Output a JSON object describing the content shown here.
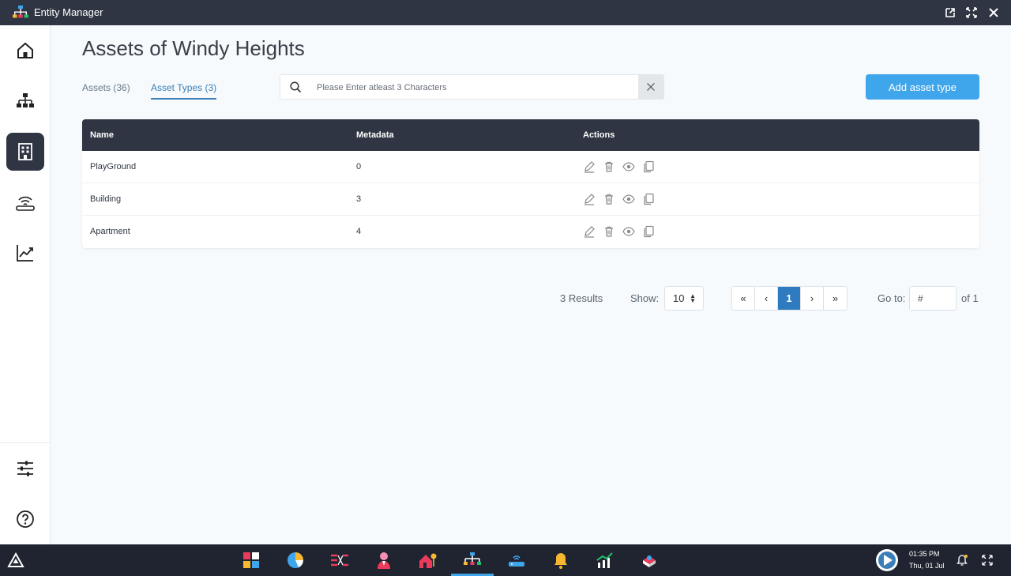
{
  "window": {
    "title": "Entity Manager"
  },
  "page": {
    "title": "Assets of Windy Heights"
  },
  "tabs": [
    {
      "label": "Assets (36)",
      "active": false
    },
    {
      "label": "Asset Types (3)",
      "active": true
    }
  ],
  "search": {
    "placeholder": "Please Enter atleast 3 Characters",
    "value": ""
  },
  "add_button": {
    "label": "Add asset type"
  },
  "table": {
    "headers": {
      "name": "Name",
      "metadata": "Metadata",
      "actions": "Actions"
    },
    "rows": [
      {
        "name": "PlayGround",
        "metadata": "0"
      },
      {
        "name": "Building",
        "metadata": "3"
      },
      {
        "name": "Apartment",
        "metadata": "4"
      }
    ],
    "row_actions": [
      "edit-icon",
      "delete-icon",
      "view-icon",
      "copy-icon"
    ]
  },
  "pagination": {
    "results": "3 Results",
    "show_label": "Show:",
    "page_size": "10",
    "first": "«",
    "prev": "‹",
    "current_page": "1",
    "next": "›",
    "last": "»",
    "goto_label": "Go to:",
    "goto_placeholder": "#",
    "of_label": "of 1"
  },
  "sidebar": {
    "items": [
      {
        "icon": "home-icon",
        "active": false
      },
      {
        "icon": "hierarchy-icon",
        "active": false
      },
      {
        "icon": "building-icon",
        "active": true
      },
      {
        "icon": "router-icon",
        "active": false
      },
      {
        "icon": "chart-line-icon",
        "active": false
      }
    ],
    "bottom": [
      {
        "icon": "sliders-icon"
      },
      {
        "icon": "help-icon"
      }
    ]
  },
  "taskbar": {
    "time": "01:35 PM",
    "date": "Thu, 01 Jul"
  },
  "colors": {
    "dark": "#2f3542",
    "accent": "#3fa6ec",
    "tab_active": "#3b7fb8",
    "page_bg": "#f6fafc"
  }
}
